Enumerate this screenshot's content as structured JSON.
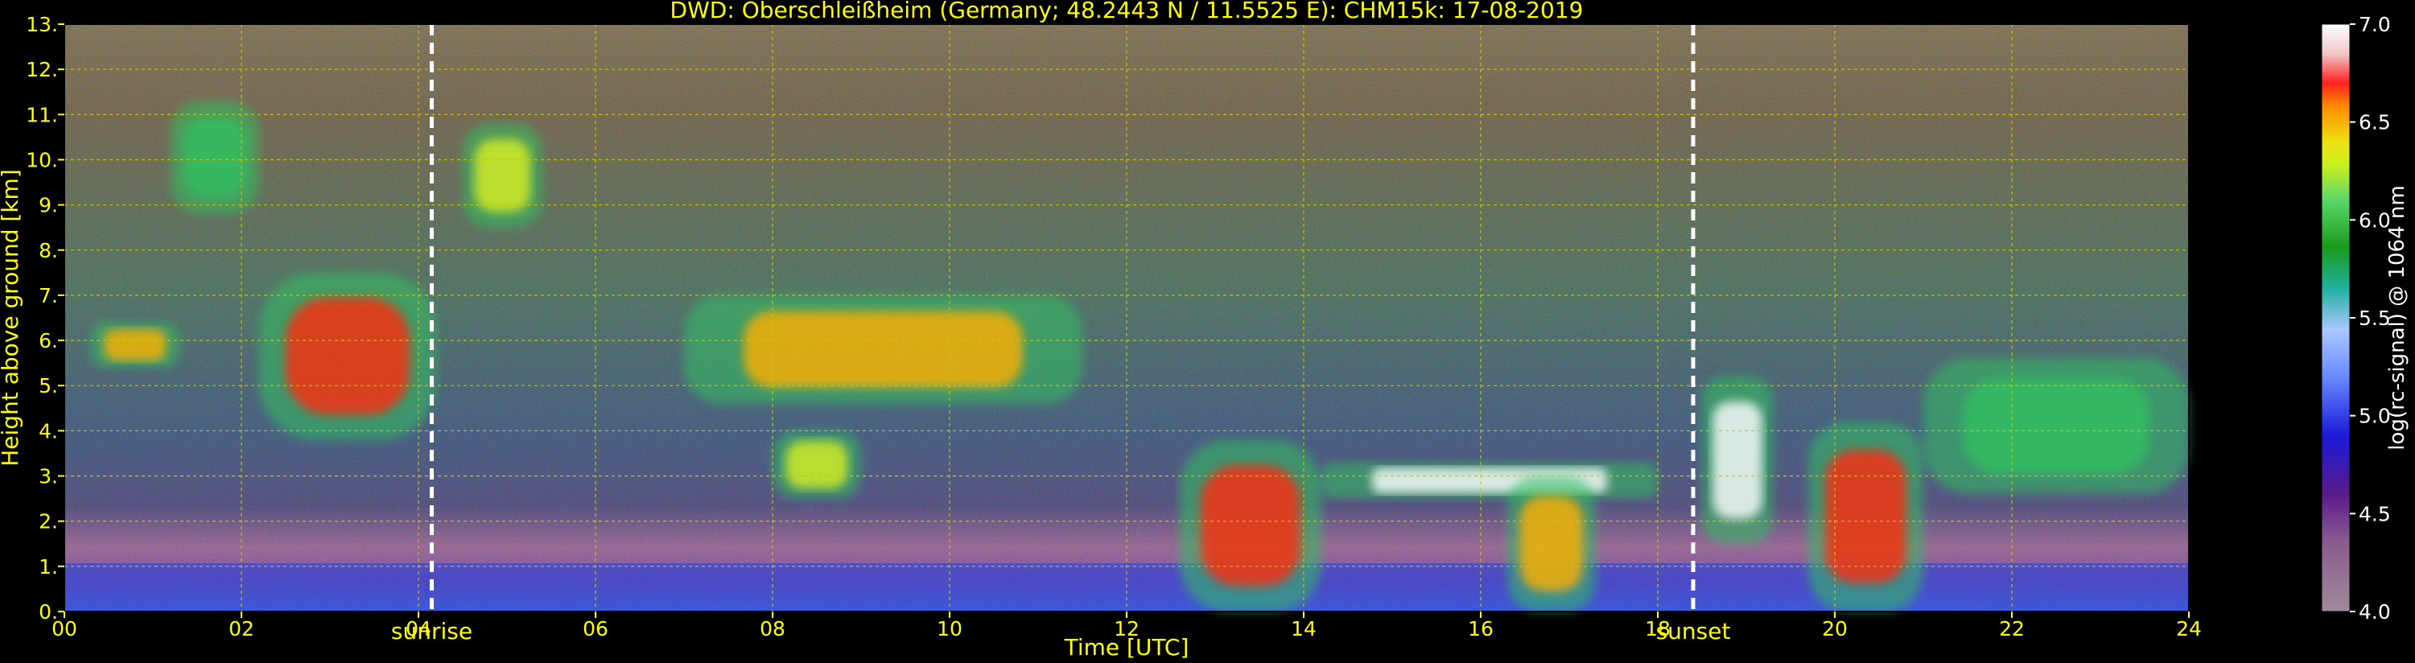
{
  "chart_data": {
    "type": "heatmap",
    "title": "DWD: Oberschleißheim (Germany; 48.2443 N / 11.5525 E):    CHM15k: 17-08-2019",
    "xlabel": "Time [UTC]",
    "ylabel": "Height above ground [km]",
    "xlim": [
      0,
      24
    ],
    "ylim": [
      0,
      13
    ],
    "x_ticks": [
      "00",
      "02",
      "04",
      "06",
      "08",
      "10",
      "12",
      "14",
      "16",
      "18",
      "20",
      "22",
      "24"
    ],
    "y_ticks": [
      "0.",
      "1.",
      "2.",
      "3.",
      "4.",
      "5.",
      "6.",
      "7.",
      "8.",
      "9.",
      "10.",
      "11.",
      "12.",
      "13."
    ],
    "grid": true,
    "markers": [
      {
        "label": "sunrise",
        "time": 4.15
      },
      {
        "label": "sunset",
        "time": 18.4
      }
    ],
    "colorbar": {
      "label": "log(rc-signal) @ 1064 nm",
      "range": [
        4.0,
        7.0
      ],
      "ticks": [
        "4.0",
        "4.5",
        "5.0",
        "5.5",
        "6.0",
        "6.5",
        "7.0"
      ]
    },
    "cloud_layers": [
      {
        "t0": 1.2,
        "t1": 2.2,
        "h0": 8.8,
        "h1": 11.3,
        "level": 0.62
      },
      {
        "t0": 0.3,
        "t1": 1.3,
        "h0": 5.4,
        "h1": 6.4,
        "level": 0.75
      },
      {
        "t0": 2.2,
        "t1": 4.2,
        "h0": 3.8,
        "h1": 7.5,
        "level": 0.85
      },
      {
        "t0": 4.5,
        "t1": 5.4,
        "h0": 8.5,
        "h1": 10.8,
        "level": 0.7
      },
      {
        "t0": 7.0,
        "t1": 11.5,
        "h0": 4.6,
        "h1": 7.0,
        "level": 0.8
      },
      {
        "t0": 8.0,
        "t1": 9.0,
        "h0": 2.5,
        "h1": 4.0,
        "level": 0.7
      },
      {
        "t0": 12.6,
        "t1": 14.2,
        "h0": 0.0,
        "h1": 3.8,
        "level": 0.85
      },
      {
        "t0": 14.2,
        "t1": 18.0,
        "h0": 2.5,
        "h1": 3.3,
        "level": 0.9
      },
      {
        "t0": 16.3,
        "t1": 17.3,
        "h0": 0.0,
        "h1": 3.0,
        "level": 0.8
      },
      {
        "t0": 18.5,
        "t1": 19.3,
        "h0": 1.5,
        "h1": 5.2,
        "level": 0.9
      },
      {
        "t0": 19.7,
        "t1": 21.0,
        "h0": 0.0,
        "h1": 4.2,
        "level": 0.85
      },
      {
        "t0": 21.0,
        "t1": 24.0,
        "h0": 2.6,
        "h1": 5.6,
        "level": 0.65
      }
    ]
  }
}
